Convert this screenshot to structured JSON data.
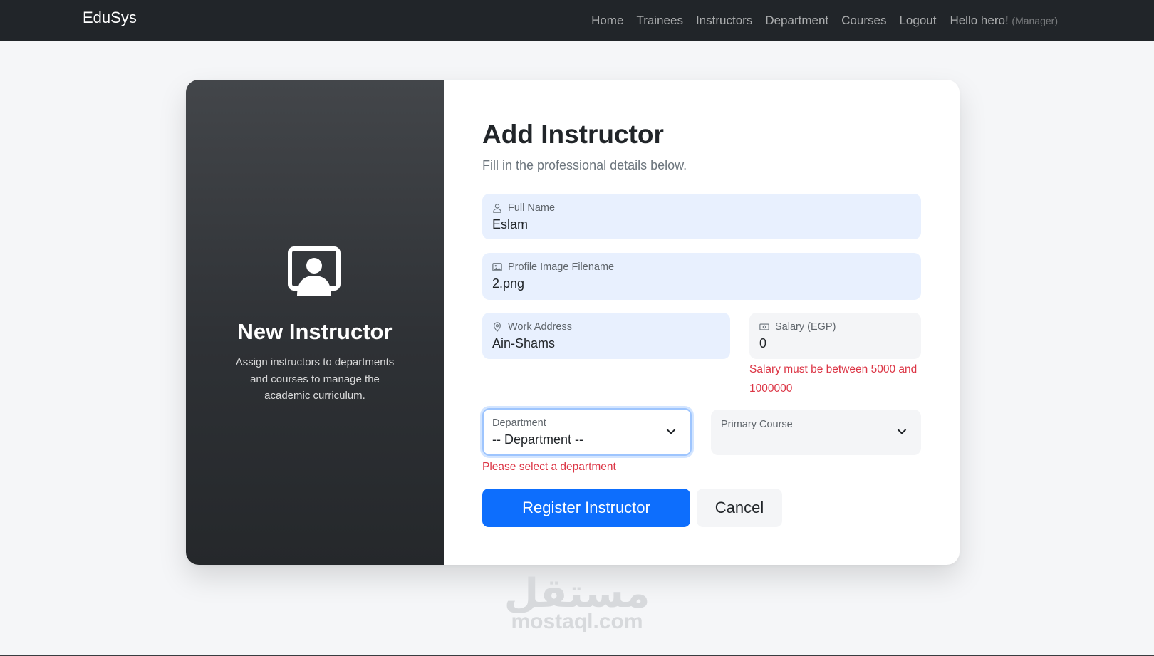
{
  "navbar": {
    "brand": "EduSys",
    "links": [
      "Home",
      "Trainees",
      "Instructors",
      "Department",
      "Courses",
      "Logout"
    ],
    "greeting": "Hello hero!",
    "role": "(Manager)"
  },
  "side_panel": {
    "icon": "instructor-icon",
    "title": "New Instructor",
    "description": "Assign instructors to departments and courses to manage the academic curriculum."
  },
  "form": {
    "title": "Add Instructor",
    "subtitle": "Fill in the professional details below.",
    "full_name": {
      "label": "Full Name",
      "value": "Eslam",
      "icon": "person-icon"
    },
    "profile_image": {
      "label": "Profile Image Filename",
      "value": "2.png",
      "icon": "image-icon"
    },
    "work_address": {
      "label": "Work Address",
      "value": "Ain-Shams",
      "icon": "location-pin-icon"
    },
    "salary": {
      "label": "Salary (EGP)",
      "value": "0",
      "icon": "cash-icon",
      "error": "Salary must be between 5000 and 1000000"
    },
    "department": {
      "label": "Department",
      "selected": "-- Department --",
      "error": "Please select a department"
    },
    "primary_course": {
      "label": "Primary Course",
      "selected": ""
    },
    "submit_label": "Register Instructor",
    "cancel_label": "Cancel"
  },
  "watermark": {
    "arabic": "مستقل",
    "latin": "mostaql.com"
  },
  "colors": {
    "navbar": "#212529",
    "primary": "#0d6efd",
    "error": "#dc3545",
    "autofill": "#e8f0fe"
  }
}
